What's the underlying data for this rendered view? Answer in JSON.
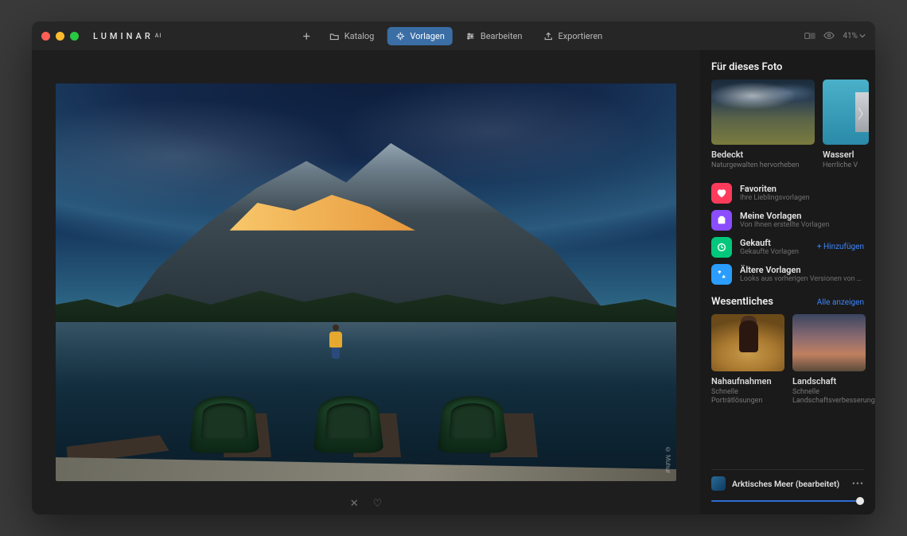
{
  "brand": {
    "name": "LUMINAR",
    "suffix": "AI"
  },
  "nav": {
    "add": "",
    "catalog": "Katalog",
    "templates": "Vorlagen",
    "edit": "Bearbeiten",
    "export": "Exportieren"
  },
  "zoom": {
    "value": "41%"
  },
  "photo": {
    "credit": "© Muhur"
  },
  "panel": {
    "forThisPhoto": {
      "title": "Für dieses Foto",
      "cards": [
        {
          "title": "Bedeckt",
          "subtitle": "Naturgewalten hervorheben"
        },
        {
          "title": "Wasserl",
          "subtitle": "Herrliche V"
        }
      ]
    },
    "collections": {
      "favorites": {
        "title": "Favoriten",
        "subtitle": "Ihre Lieblingsvorlagen"
      },
      "mine": {
        "title": "Meine Vorlagen",
        "subtitle": "Von Ihnen erstellte Vorlagen"
      },
      "purchased": {
        "title": "Gekauft",
        "subtitle": "Gekaufte Vorlagen",
        "action": "+ Hinzufügen"
      },
      "legacy": {
        "title": "Ältere Vorlagen",
        "subtitle": "Looks aus vorherigen Versionen von Luminar"
      }
    },
    "essentials": {
      "title": "Wesentliches",
      "showAll": "Alle anzeigen",
      "cards": [
        {
          "title": "Nahaufnahmen",
          "subtitle": "Schnelle Porträtlösungen"
        },
        {
          "title": "Landschaft",
          "subtitle": "Schnelle Landschaftsverbesserungen"
        }
      ]
    },
    "applied": {
      "name": "Arktisches Meer (bearbeitet)",
      "more": "•••"
    }
  }
}
